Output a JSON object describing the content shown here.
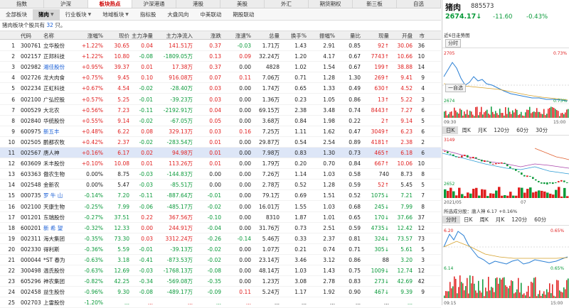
{
  "top_tabs": [
    "指数",
    "沪深",
    "板块热点",
    "沪深港通",
    "港股",
    "美股",
    "外汇",
    "期货期权",
    "新三板",
    "自选"
  ],
  "top_tab_active": 2,
  "sub_tabs": [
    {
      "label": "全部板块",
      "caret": false
    },
    {
      "label": "猪肉",
      "caret": true,
      "active": true
    },
    {
      "label": "行业板块",
      "caret": true
    },
    {
      "label": "地域板块",
      "caret": true
    },
    {
      "label": "指标股",
      "caret": false
    },
    {
      "label": "大盘风向",
      "caret": false
    },
    {
      "label": "中美联动",
      "caret": false
    },
    {
      "label": "期股联动",
      "caret": false
    }
  ],
  "banner": {
    "prefix": "猪肉板块个股共有 ",
    "count": "32",
    "suffix": " 只。"
  },
  "columns": [
    "",
    "代码",
    "名称",
    "涨幅%",
    "现价",
    "主力净量",
    "主力净流入",
    "涨跌",
    "涨速%",
    "总量",
    "换手%",
    "振幅%",
    "量比",
    "现量",
    "开盘",
    "市"
  ],
  "rows": [
    [
      "1",
      "300761",
      "立华股份",
      "+1.22%",
      "30.65",
      "0.04",
      "141.51万",
      "0.37",
      "-0.03",
      "1.71万",
      "1.43",
      "2.91",
      "0.85",
      "92↑",
      "30.06",
      "36"
    ],
    [
      "2",
      "002157",
      "正邦科技",
      "+1.22%",
      "10.80",
      "-0.08",
      "-1809.05万",
      "0.13",
      "0.09",
      "32.24万",
      "1.20",
      "4.17",
      "0.67",
      "7743↑",
      "10.66",
      "10"
    ],
    [
      "3",
      "002982",
      "湘佳股份",
      "+0.95%",
      "39.37",
      "0.01",
      "17.38万",
      "0.37",
      "0.00",
      "4828",
      "1.02",
      "1.54",
      "0.67",
      "199↑",
      "38.88",
      "14"
    ],
    [
      "4",
      "002726",
      "龙大肉食",
      "+0.75%",
      "9.45",
      "0.10",
      "916.08万",
      "0.07",
      "0.11",
      "7.06万",
      "0.71",
      "1.28",
      "1.30",
      "269↑",
      "9.41",
      "9"
    ],
    [
      "5",
      "002234",
      "正虹科技",
      "+0.67%",
      "4.54",
      "-0.02",
      "-28.40万",
      "0.03",
      "0.00",
      "1.74万",
      "0.65",
      "1.33",
      "0.49",
      "630↑",
      "4.52",
      "4"
    ],
    [
      "6",
      "002100",
      "广弘控股",
      "+0.57%",
      "5.25",
      "-0.01",
      "-39.23万",
      "0.03",
      "0.00",
      "1.36万",
      "0.23",
      "1.05",
      "0.86",
      "13↑",
      "5.22",
      "3"
    ],
    [
      "7",
      "000529",
      "大北农",
      "+0.56%",
      "7.23",
      "-0.11",
      "-2192.91万",
      "0.04",
      "0.00",
      "69.15万",
      "2.38",
      "3.48",
      "0.74",
      "8443↑",
      "7.27",
      "6"
    ],
    [
      "8",
      "002840",
      "华统股份",
      "+0.55%",
      "9.14",
      "-0.02",
      "-67.05万",
      "0.05",
      "0.00",
      "3.68万",
      "0.84",
      "1.98",
      "0.22",
      "2↑",
      "9.14",
      "5"
    ],
    [
      "9",
      "600975",
      "新五丰",
      "+0.48%",
      "6.22",
      "0.08",
      "329.13万",
      "0.03",
      "0.16",
      "7.25万",
      "1.11",
      "1.62",
      "0.47",
      "3049↑",
      "6.23",
      "6"
    ],
    [
      "10",
      "002505",
      "鹏都农牧",
      "+0.42%",
      "2.37",
      "-0.02",
      "-283.54万",
      "0.01",
      "0.00",
      "29.87万",
      "0.54",
      "2.54",
      "0.89",
      "4181↑",
      "2.38",
      "2"
    ],
    [
      "11",
      "002567",
      "唐人神",
      "+0.16%",
      "6.17",
      "0.02",
      "94.98万",
      "0.01",
      "0.00",
      "7.98万",
      "0.83",
      "1.30",
      "0.73",
      "465↑",
      "6.18",
      "6"
    ],
    [
      "12",
      "603609",
      "禾丰股份",
      "+0.10%",
      "10.08",
      "0.01",
      "113.26万",
      "0.01",
      "0.00",
      "1.79万",
      "0.20",
      "0.70",
      "0.84",
      "667↑",
      "10.06",
      "10"
    ],
    [
      "13",
      "603363",
      "傲农生物",
      "0.00%",
      "8.75",
      "-0.03",
      "-144.83万",
      "0.00",
      "0.00",
      "7.26万",
      "1.14",
      "1.03",
      "0.58",
      "740",
      "8.73",
      "8"
    ],
    [
      "14",
      "002548",
      "金新农",
      "0.00%",
      "5.47",
      "-0.03",
      "-85.51万",
      "0.00",
      "0.00",
      "2.78万",
      "0.52",
      "1.28",
      "0.59",
      "52↑",
      "5.45",
      "5"
    ],
    [
      "15",
      "000735",
      "罗 牛 山",
      "-0.14%",
      "7.20",
      "-0.11",
      "-887.64万",
      "-0.01",
      "0.00",
      "79.1万",
      "0.69",
      "1.51",
      "0.52",
      "1075↓",
      "7.21",
      "7"
    ],
    [
      "16",
      "002100",
      "天康生物",
      "-0.25%",
      "7.99",
      "-0.06",
      "-485.17万",
      "-0.02",
      "0.00",
      "16.01万",
      "1.55",
      "1.03",
      "0.68",
      "245↓",
      "7.99",
      "8"
    ],
    [
      "17",
      "001201",
      "东瑞股份",
      "-0.27%",
      "37.51",
      "0.22",
      "367.56万",
      "-0.10",
      "0.00",
      "8310",
      "1.87",
      "1.01",
      "0.65",
      "170↓",
      "37.66",
      "37"
    ],
    [
      "18",
      "600201",
      "新 希 望",
      "-0.32%",
      "12.33",
      "0.00",
      "244.91万",
      "-0.04",
      "0.00",
      "31.76万",
      "0.73",
      "2.51",
      "0.59",
      "4735↓",
      "12.42",
      "12"
    ],
    [
      "19",
      "002311",
      "海大集团",
      "-0.35%",
      "73.30",
      "0.03",
      "3312.24万",
      "-0.26",
      "-0.14",
      "5.46万",
      "0.33",
      "2.37",
      "0.81",
      "324↓",
      "73.57",
      "73"
    ],
    [
      "20",
      "002330",
      "得利斯",
      "-0.36%",
      "5.59",
      "-0.01",
      "-39.13万",
      "-0.02",
      "0.00",
      "1.07万",
      "0.21",
      "0.74",
      "0.71",
      "305↓",
      "5.61",
      "5"
    ],
    [
      "21",
      "000044",
      "*ST 春为",
      "-0.63%",
      "3.18",
      "-0.41",
      "-873.53万",
      "-0.02",
      "0.00",
      "23.14万",
      "3.46",
      "3.12",
      "0.86",
      "88",
      "3.20",
      "3"
    ],
    [
      "22",
      "300498",
      "温氏股份",
      "-0.63%",
      "12.69",
      "-0.03",
      "-1768.13万",
      "-0.08",
      "0.00",
      "48.14万",
      "1.03",
      "1.43",
      "0.75",
      "1009↓",
      "12.74",
      "12"
    ],
    [
      "23",
      "605296",
      "神农集团",
      "-0.82%",
      "42.25",
      "-0.34",
      "-569.08万",
      "-0.35",
      "0.00",
      "1.23万",
      "3.08",
      "2.78",
      "0.83",
      "273↓",
      "42.69",
      "42"
    ],
    [
      "24",
      "002458",
      "益生股份",
      "-0.96%",
      "9.30",
      "-0.08",
      "-489.17万",
      "-0.09",
      "0.11",
      "5.24万",
      "1.17",
      "1.92",
      "0.90",
      "467↓",
      "9.39",
      "9"
    ],
    [
      "25",
      "002703",
      "上雷股份",
      "-1.20%",
      "...",
      "...",
      "...",
      "...",
      "...",
      "...",
      "...",
      "...",
      "...",
      "...",
      "...",
      ""
    ]
  ],
  "selected_row": 10,
  "right": {
    "title": "猪肉",
    "code": "885573",
    "price": "2674.17",
    "arrow": "↓",
    "change": "-11.60",
    "pct": "-0.43%",
    "intraday_title": "近6日走势图",
    "intraday_btn": "分时",
    "self_btn": "一自选",
    "intraday_hi": "2705",
    "intraday_lo": "2674",
    "pct_hi": "0.73%",
    "pct_lo": "0.73%",
    "time_start": "09:30",
    "time_end": "15:00",
    "periods": [
      "日K",
      "周K",
      "月K",
      "120分",
      "60分",
      "30分"
    ],
    "kline_hi": "3149",
    "kline_lo": "2652",
    "kline_date1": "2021/05",
    "kline_date2": "07",
    "stock_title": "所选成分股：唐人神 6.17 +0.16%",
    "stock_periods": [
      "分时",
      "日K",
      "周K",
      "月K",
      "120分",
      "60分"
    ],
    "stock_hi": "6.20",
    "stock_lo": "6.14",
    "stock_pct_hi": "0.65%",
    "stock_pct_lo": "0.65%",
    "stock_time_start": "09:15",
    "stock_time_end": "15:00",
    "accent_red": "#e02020",
    "accent_green": "#0a9a3a"
  }
}
